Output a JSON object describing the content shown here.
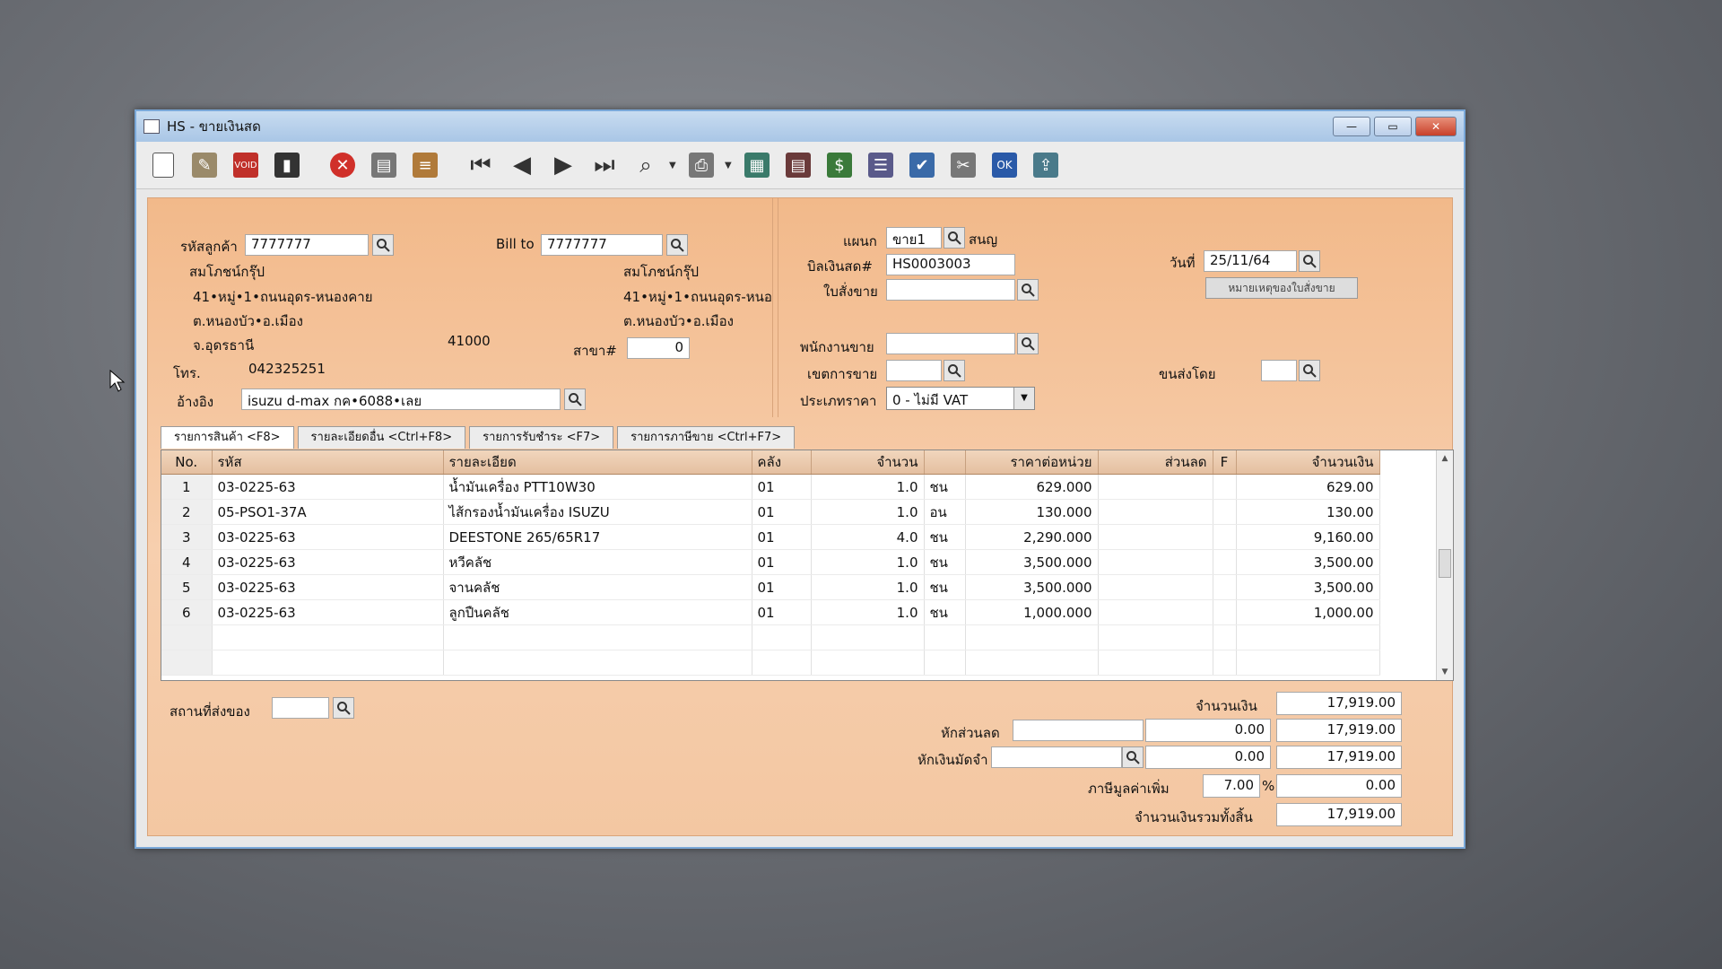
{
  "window": {
    "title": "HS - ขายเงินสด"
  },
  "toolbar": {
    "icons": [
      "new-icon",
      "edit-icon",
      "void-icon",
      "trash-icon",
      "cancel-icon",
      "save-icon",
      "stack-icon",
      "first-icon",
      "prev-icon",
      "next-icon",
      "last-icon",
      "find-icon",
      "print-icon",
      "calc-icon",
      "report-icon",
      "cash-icon",
      "list-icon",
      "stamp-ok-icon",
      "tools-icon",
      "ok-icon",
      "export-icon"
    ]
  },
  "customer": {
    "code_label": "รหัสลูกค้า",
    "code": "7777777",
    "name": "สมโภชน์กรุ๊ป",
    "addr1": "41•หมู่•1•ถนนอุดร-หนองคาย",
    "addr2": "ต.หนองบัว•อ.เมือง",
    "addr3": "จ.อุดรธานี",
    "zip": "41000",
    "phone_label": "โทร.",
    "phone": "042325251",
    "ref_label": "อ้างอิง",
    "ref": "isuzu d-max กค•6088•เลย"
  },
  "billto": {
    "label": "Bill to",
    "code": "7777777",
    "name": "สมโภชน์กรุ๊ป",
    "addr1": "41•หมู่•1•ถนนอุดร-หนอ",
    "addr2": "ต.หนองบัว•อ.เมือง",
    "branch_label": "สาขา#",
    "branch": "0"
  },
  "doc": {
    "dept_label": "แผนก",
    "dept": "ขาย1",
    "dept_name": "สนญ",
    "bill_label": "บิลเงินสด#",
    "bill": "HS0003003",
    "date_label": "วันที่",
    "date": "25/11/64",
    "so_label": "ใบสั่งขาย",
    "so": "",
    "remark_btn": "หมายเหตุของใบสั่งขาย",
    "salesman_label": "พนักงานขาย",
    "salesman": "",
    "area_label": "เขตการขาย",
    "area": "",
    "ship_label": "ขนส่งโดย",
    "ship": "",
    "pricetype_label": "ประเภทราคา",
    "pricetype": "0 - ไม่มี VAT"
  },
  "tabs": [
    {
      "label": "รายการสินค้า <F8>"
    },
    {
      "label": "รายละเอียดอื่น <Ctrl+F8>"
    },
    {
      "label": "รายการรับชำระ <F7>"
    },
    {
      "label": "รายการภาษีขาย <Ctrl+F7>"
    }
  ],
  "grid": {
    "headers": {
      "no": "No.",
      "code": "รหัส",
      "desc": "รายละเอียด",
      "wh": "คลัง",
      "qty": "จำนวน",
      "price": "ราคาต่อหน่วย",
      "disc": "ส่วนลด",
      "f": "F",
      "amount": "จำนวนเงิน"
    },
    "rows": [
      {
        "no": "1",
        "code": "03-0225-63",
        "desc": "น้ำมันเครื่อง PTT10W30",
        "wh": "01",
        "qty": "1.0",
        "unit": "ชน",
        "price": "629.000",
        "disc": "",
        "f": "",
        "amount": "629.00"
      },
      {
        "no": "2",
        "code": "05-PSO1-37A",
        "desc": "ไส้กรองน้ำมันเครื่อง ISUZU",
        "wh": "01",
        "qty": "1.0",
        "unit": "อน",
        "price": "130.000",
        "disc": "",
        "f": "",
        "amount": "130.00"
      },
      {
        "no": "3",
        "code": "03-0225-63",
        "desc": "DEESTONE 265/65R17",
        "wh": "01",
        "qty": "4.0",
        "unit": "ชน",
        "price": "2,290.000",
        "disc": "",
        "f": "",
        "amount": "9,160.00"
      },
      {
        "no": "4",
        "code": "03-0225-63",
        "desc": "หวีคลัช",
        "wh": "01",
        "qty": "1.0",
        "unit": "ชน",
        "price": "3,500.000",
        "disc": "",
        "f": "",
        "amount": "3,500.00"
      },
      {
        "no": "5",
        "code": "03-0225-63",
        "desc": "จานคลัช",
        "wh": "01",
        "qty": "1.0",
        "unit": "ชน",
        "price": "3,500.000",
        "disc": "",
        "f": "",
        "amount": "3,500.00"
      },
      {
        "no": "6",
        "code": "03-0225-63",
        "desc": "ลูกปืนคลัช",
        "wh": "01",
        "qty": "1.0",
        "unit": "ชน",
        "price": "1,000.000",
        "disc": "",
        "f": "",
        "amount": "1,000.00"
      }
    ]
  },
  "footer": {
    "shipto_label": "สถานที่ส่งของ",
    "shipto": "",
    "amount_label": "จำนวนเงิน",
    "amount": "17,919.00",
    "discount_label": "หักส่วนลด",
    "discount_text": "",
    "discount": "0.00",
    "after_discount": "17,919.00",
    "deposit_label": "หักเงินมัดจำ",
    "deposit_text": "",
    "deposit": "0.00",
    "after_deposit": "17,919.00",
    "vat_label": "ภาษีมูลค่าเพิ่ม",
    "vat_rate": "7.00",
    "vat_pct": "%",
    "vat": "0.00",
    "total_label": "จำนวนเงินรวมทั้งสิ้น",
    "total": "17,919.00"
  }
}
